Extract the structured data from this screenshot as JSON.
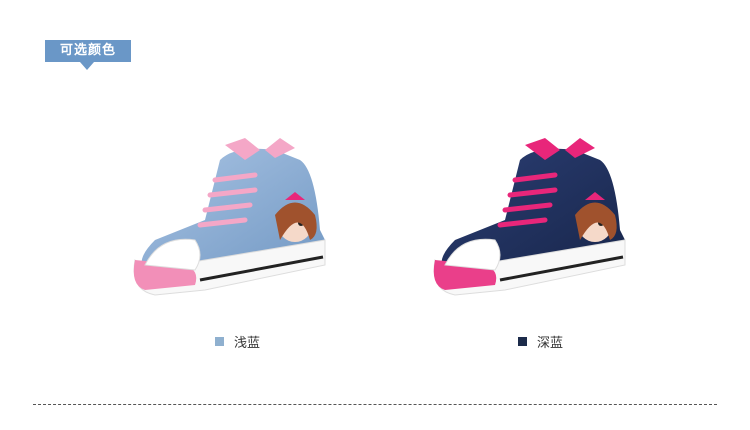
{
  "section_tag": {
    "label": "可选颜色",
    "color": "#6a97c7"
  },
  "variants": [
    {
      "label": "浅蓝",
      "swatch_color": "#8fb0cf",
      "accent_color": "#f4a7c7",
      "denim_color": "#8fb0d8",
      "sole_color": "#f28fb8"
    },
    {
      "label": "深蓝",
      "swatch_color": "#1c2b4a",
      "accent_color": "#e8267a",
      "denim_color": "#1f3263",
      "sole_color": "#ea3f8a"
    }
  ]
}
